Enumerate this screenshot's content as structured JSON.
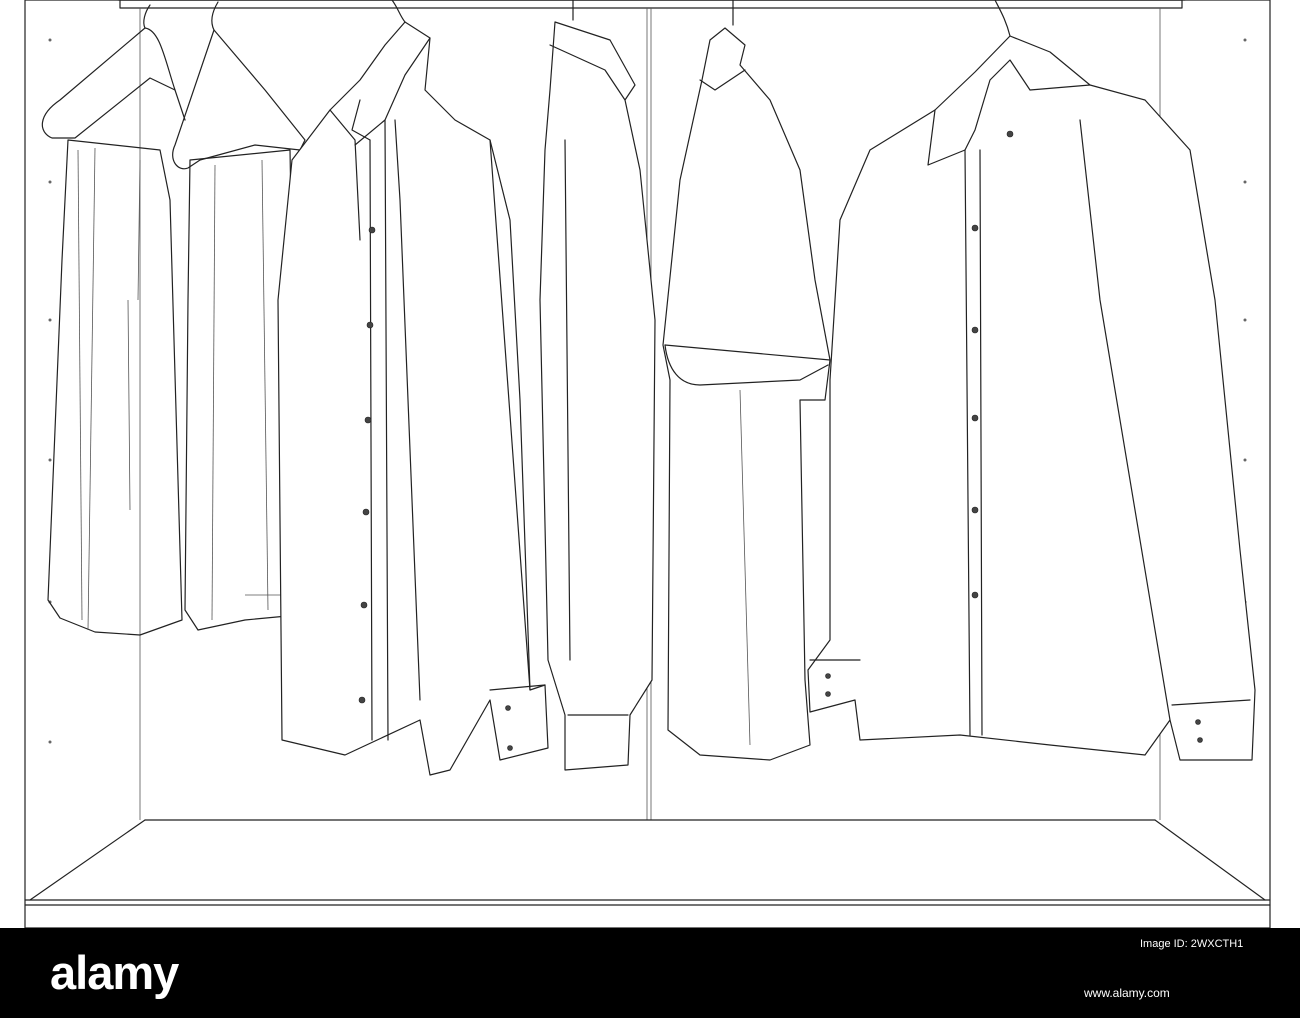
{
  "scene": {
    "subject": "line drawing of shirts hanging in a wardrobe",
    "colors": {
      "background": "#ffffff",
      "line": "#222222",
      "footer": "#000000",
      "footer_text": "#ffffff"
    }
  },
  "watermark": {
    "brand": "alamy",
    "image_id_label": "Image ID: 2WXCTH1",
    "url": "www.alamy.com"
  }
}
